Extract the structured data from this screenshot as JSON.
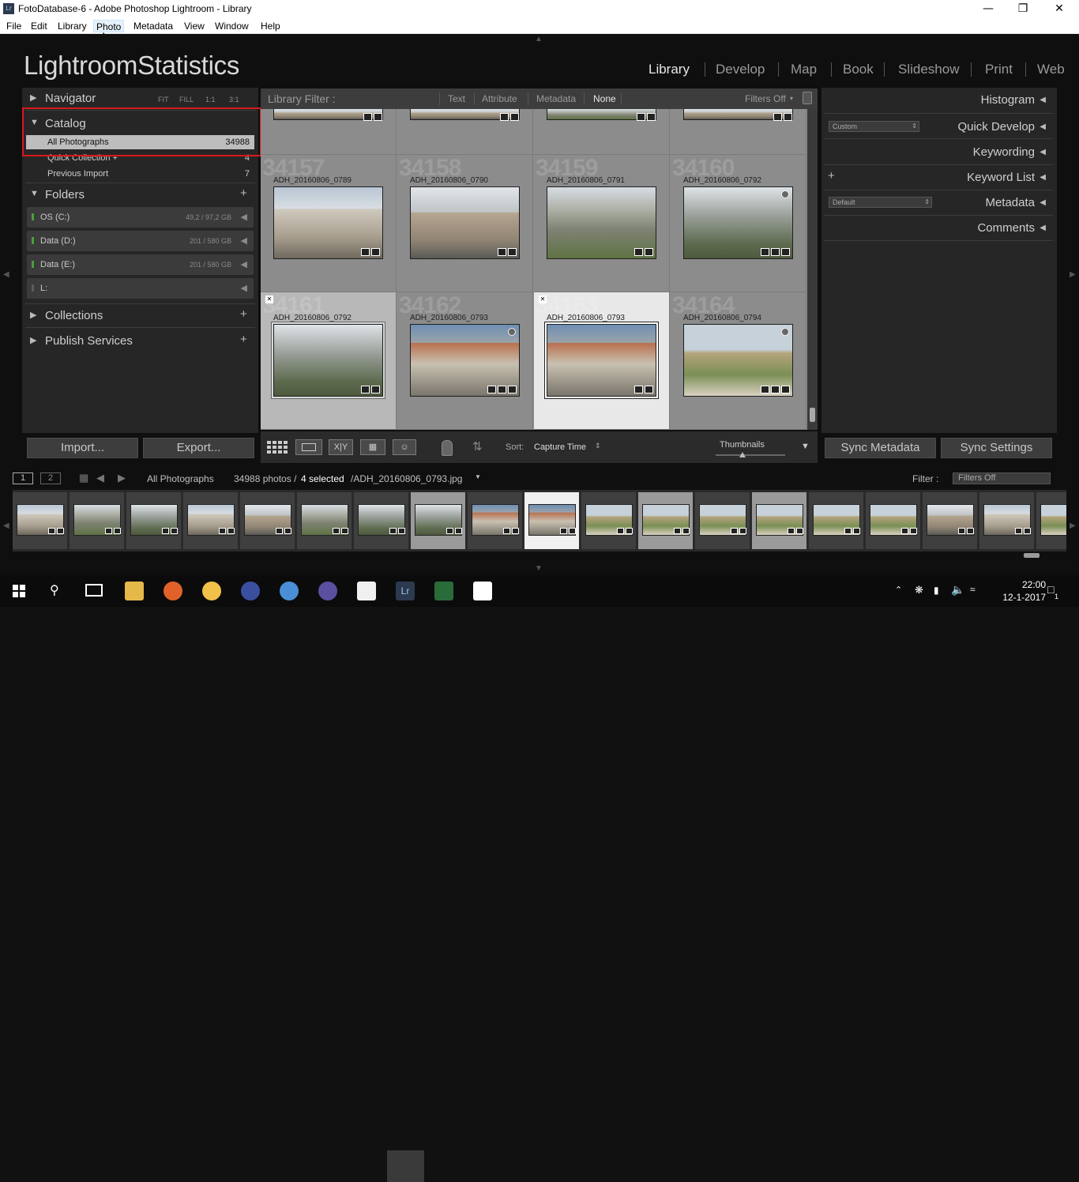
{
  "window": {
    "title": "FotoDatabase-6 - Adobe Photoshop Lightroom - Library",
    "app_icon": "Lr",
    "controls": [
      "minimize-icon",
      "restore-icon",
      "close-icon"
    ]
  },
  "menu": [
    "File",
    "Edit",
    "Library",
    "Photo",
    "Metadata",
    "View",
    "Window",
    "Help"
  ],
  "menu_active": "Photo",
  "identity_plate": "LightroomStatistics",
  "modules": [
    {
      "label": "Library",
      "active": true
    },
    {
      "label": "Develop"
    },
    {
      "label": "Map"
    },
    {
      "label": "Book"
    },
    {
      "label": "Slideshow"
    },
    {
      "label": "Print"
    },
    {
      "label": "Web"
    }
  ],
  "left_panel": {
    "navigator": {
      "title": "Navigator",
      "zoom": [
        "FIT",
        "FILL",
        "1:1",
        "3:1"
      ]
    },
    "catalog": {
      "title": "Catalog",
      "items": [
        {
          "label": "All Photographs",
          "count": "34988",
          "selected": true
        },
        {
          "label": "Quick Collection  +",
          "count": "4"
        },
        {
          "label": "Previous Import",
          "count": "7"
        }
      ]
    },
    "folders": {
      "title": "Folders",
      "items": [
        {
          "name": "OS (C:)",
          "size": "49,2 / 97,2 GB",
          "online": true
        },
        {
          "name": "Data (D:)",
          "size": "201 / 580 GB",
          "online": true
        },
        {
          "name": "Data (E:)",
          "size": "201 / 580 GB",
          "online": true
        },
        {
          "name": "L:",
          "size": "",
          "online": false
        }
      ]
    },
    "collections": "Collections",
    "publish": "Publish Services",
    "import_btn": "Import...",
    "export_btn": "Export..."
  },
  "filter_bar": {
    "title": "Library Filter :",
    "options": [
      "Text",
      "Attribute",
      "Metadata",
      "None"
    ],
    "active": "None",
    "status": "Filters Off"
  },
  "grid": {
    "rows": [
      {
        "cells": [
          {
            "idx": "",
            "name": "",
            "scene": "sc-castle2"
          },
          {
            "idx": "",
            "name": "",
            "scene": "sc-castle2"
          },
          {
            "idx": "",
            "name": "",
            "scene": "sc-ruin"
          },
          {
            "idx": "",
            "name": "",
            "scene": "sc-castle2"
          }
        ]
      },
      {
        "cells": [
          {
            "idx": "34157",
            "name": "ADH_20160806_0789",
            "scene": "sc-castle"
          },
          {
            "idx": "34158",
            "name": "ADH_20160806_0790",
            "scene": "sc-castle2"
          },
          {
            "idx": "34159",
            "name": "ADH_20160806_0791",
            "scene": "sc-ruin"
          },
          {
            "idx": "34160",
            "name": "ADH_20160806_0792",
            "scene": "sc-rock"
          }
        ]
      },
      {
        "cells": [
          {
            "idx": "34161",
            "name": "ADH_20160806_0792",
            "scene": "sc-rock",
            "state": "sel",
            "x": true
          },
          {
            "idx": "34162",
            "name": "ADH_20160806_0793",
            "scene": "sc-court"
          },
          {
            "idx": "34163",
            "name": "ADH_20160806_0793",
            "scene": "sc-court",
            "state": "sel2",
            "x": true
          },
          {
            "idx": "34164",
            "name": "ADH_20160806_0794",
            "scene": "sc-land"
          }
        ]
      }
    ]
  },
  "toolbar": {
    "sort_label": "Sort:",
    "sort_value": "Capture Time",
    "thumb_label": "Thumbnails",
    "views": [
      "grid-view-icon",
      "loupe-view-icon",
      "compare-view-icon",
      "survey-view-icon",
      "people-view-icon"
    ],
    "compare_text": "X|Y"
  },
  "right_panel": {
    "sections": [
      "Histogram",
      "Quick Develop",
      "Keywording",
      "Keyword List",
      "Metadata",
      "Comments"
    ],
    "quick_develop_preset": "Custom",
    "metadata_preset": "Default",
    "sync_metadata": "Sync Metadata",
    "sync_settings": "Sync Settings"
  },
  "filmstrip_bar": {
    "view1": "1",
    "view2": "2",
    "source": "All Photographs",
    "count_prefix": "34988 photos /",
    "count_selected": "4 selected",
    "count_file": "/ADH_20160806_0793.jpg",
    "filter_label": "Filter :",
    "filter_value": "Filters Off"
  },
  "filmstrip": [
    {
      "scene": "sc-castle"
    },
    {
      "scene": "sc-ruin"
    },
    {
      "scene": "sc-rock"
    },
    {
      "scene": "sc-castle"
    },
    {
      "scene": "sc-castle2"
    },
    {
      "scene": "sc-ruin"
    },
    {
      "scene": "sc-rock"
    },
    {
      "scene": "sc-rock",
      "state": "sel"
    },
    {
      "scene": "sc-court"
    },
    {
      "scene": "sc-court",
      "state": "sel2"
    },
    {
      "scene": "sc-land"
    },
    {
      "scene": "sc-land",
      "state": "sel"
    },
    {
      "scene": "sc-land"
    },
    {
      "scene": "sc-land",
      "state": "sel"
    },
    {
      "scene": "sc-land"
    },
    {
      "scene": "sc-land"
    },
    {
      "scene": "sc-castle2"
    },
    {
      "scene": "sc-castle"
    },
    {
      "scene": "sc-land"
    }
  ],
  "taskbar": {
    "time": "22:00",
    "date": "12-1-2017",
    "notifications": "1"
  }
}
